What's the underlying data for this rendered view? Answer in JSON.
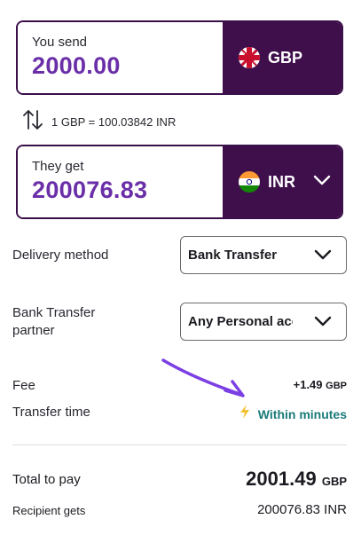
{
  "send": {
    "label": "You send",
    "amount": "2000.00",
    "currency": "GBP",
    "flag_icon": "uk-flag-icon"
  },
  "rate": {
    "text": "1 GBP = 100.03842 INR",
    "icon": "swap-arrows-icon"
  },
  "receive": {
    "label": "They get",
    "amount": "200076.83",
    "currency": "INR",
    "flag_icon": "india-flag-icon"
  },
  "delivery": {
    "label": "Delivery method",
    "selected": "Bank Transfer"
  },
  "partner": {
    "label": "Bank Transfer partner",
    "selected": "Any Personal account"
  },
  "fee": {
    "label": "Fee",
    "amount": "+1.49",
    "currency": "GBP"
  },
  "transfer_time": {
    "label": "Transfer time",
    "value": "Within minutes",
    "icon": "lightning-icon"
  },
  "total": {
    "label": "Total to pay",
    "amount": "2001.49",
    "currency": "GBP"
  },
  "recipient": {
    "label": "Recipient gets",
    "amount": "200076.83 INR"
  },
  "colors": {
    "brand_purple": "#3f0f4c",
    "amount_purple": "#6a2fa8",
    "teal": "#1b7a7a",
    "annotation": "#7b3fe4"
  }
}
